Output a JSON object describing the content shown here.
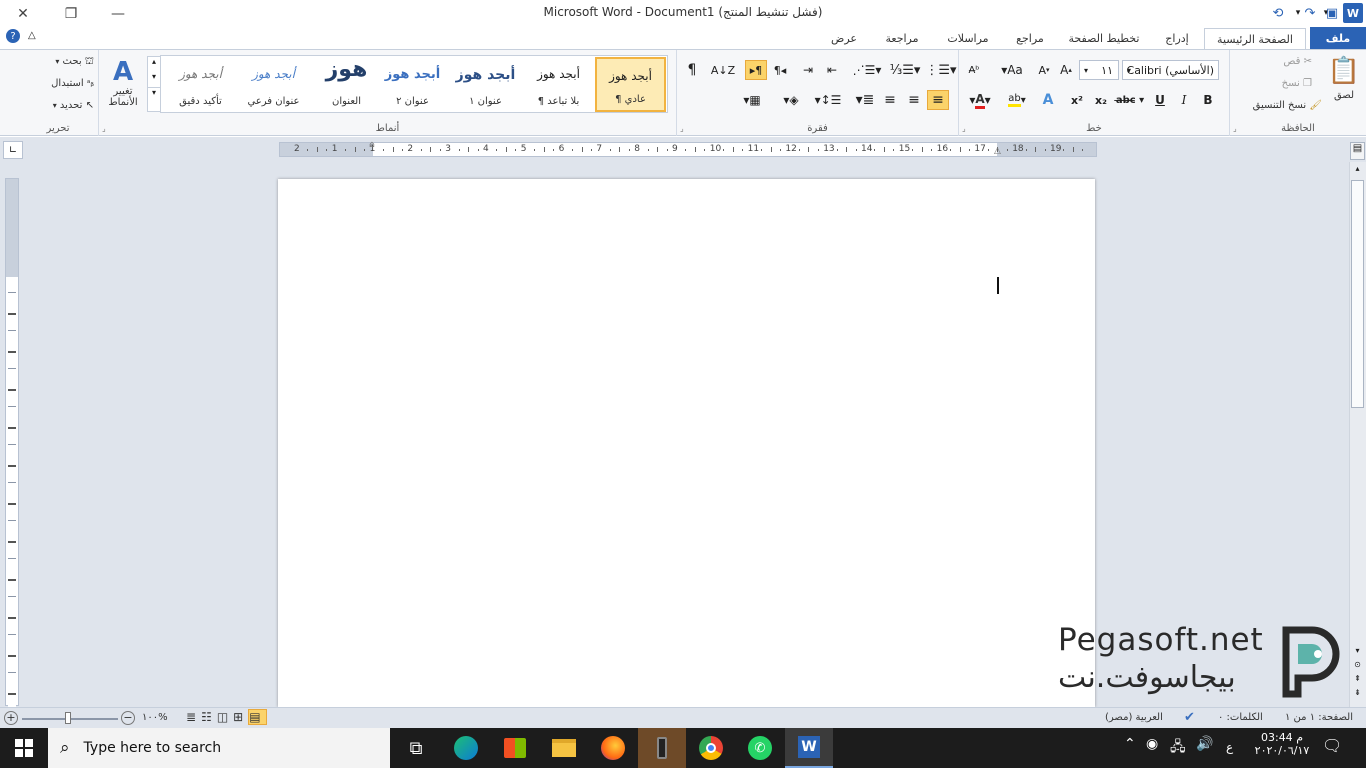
{
  "window": {
    "title": "Microsoft Word  - Document1 (فشل تنشيط المنتج)"
  },
  "tabs": {
    "file": "ملف",
    "home": "الصفحة الرئيسية",
    "insert": "إدراج",
    "layout": "تخطيط الصفحة",
    "references": "مراجع",
    "mailings": "مراسلات",
    "review": "مراجعة",
    "view": "عرض"
  },
  "clipboard": {
    "paste": "لصق",
    "cut": "قص",
    "copy": "نسخ",
    "format_painter": "نسخ التنسيق",
    "label": "الحافظة"
  },
  "font": {
    "name": "Calibri (الأساسي)",
    "size": "١١",
    "label": "خط"
  },
  "paragraph": {
    "label": "فقرة"
  },
  "styles": {
    "label": "أنماط",
    "items": [
      {
        "preview": "أبجد هوز",
        "name": "¶ عادي"
      },
      {
        "preview": "أبجد هوز",
        "name": "¶ بلا تباعد"
      },
      {
        "preview": "أبجد هوز",
        "name": "عنوان ١"
      },
      {
        "preview": "أبجد هوز",
        "name": "عنوان ٢"
      },
      {
        "preview": "هوز",
        "name": "العنوان"
      },
      {
        "preview": "أبجد هوز",
        "name": "عنوان فرعي"
      },
      {
        "preview": "أبجد هوز",
        "name": "تأكيد دقيق"
      }
    ],
    "change": "تغيير الأنماط"
  },
  "editing": {
    "find": "بحث",
    "replace": "استبدال",
    "select": "تحديد",
    "label": "تحرير"
  },
  "ruler": {
    "h": [
      "2",
      "1",
      "1",
      "2",
      "3",
      "4",
      "5",
      "6",
      "7",
      "8",
      "9",
      "10",
      "11",
      "12",
      "13",
      "14",
      "15",
      "16",
      "17",
      "18",
      "19"
    ]
  },
  "logo": {
    "latin": "Pegasoft.net",
    "arabic": "بيجاسوفت.نت"
  },
  "status": {
    "page": "الصفحة: ١ من ١",
    "words": "الكلمات: ٠",
    "lang": "العربية (مصر)",
    "zoom": "١٠٠%"
  },
  "taskbar": {
    "search": "Type here to search",
    "time": "03:44 م",
    "date": "٢٠٢٠/٠٦/١٧",
    "lang": "ع"
  }
}
